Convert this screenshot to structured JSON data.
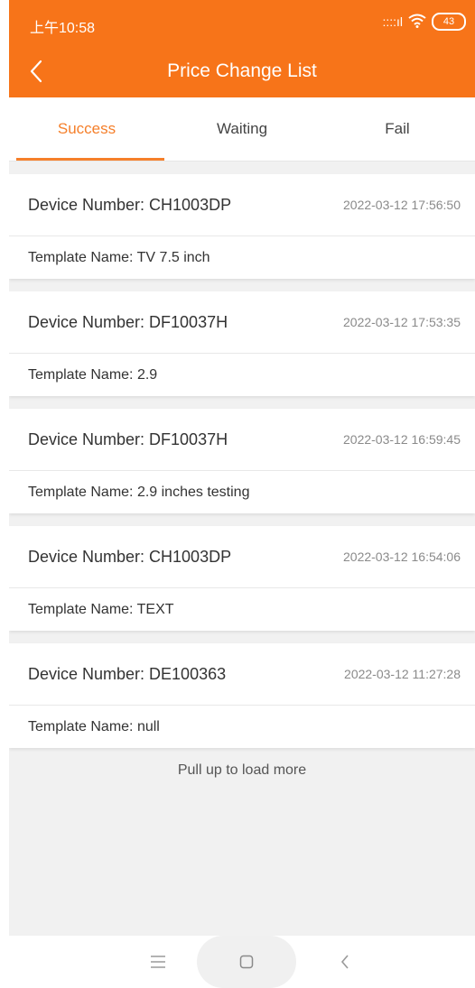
{
  "status_bar": {
    "time": "上午10:58",
    "signal": "::::ıl",
    "battery": "43"
  },
  "app_bar": {
    "title": "Price Change List"
  },
  "tabs": [
    {
      "label": "Success",
      "active": true
    },
    {
      "label": "Waiting",
      "active": false
    },
    {
      "label": "Fail",
      "active": false
    }
  ],
  "records": [
    {
      "device": "Device Number: CH1003DP",
      "time": "2022-03-12 17:56:50",
      "template": "Template Name: TV 7.5 inch"
    },
    {
      "device": "Device Number: DF10037H",
      "time": "2022-03-12 17:53:35",
      "template": "Template Name: 2.9"
    },
    {
      "device": "Device Number: DF10037H",
      "time": "2022-03-12 16:59:45",
      "template": "Template Name: 2.9 inches testing"
    },
    {
      "device": "Device Number: CH1003DP",
      "time": "2022-03-12 16:54:06",
      "template": "Template Name: TEXT"
    },
    {
      "device": "Device Number: DE100363",
      "time": "2022-03-12 11:27:28",
      "template": "Template Name: null"
    }
  ],
  "load_more": "Pull up to load more",
  "colors": {
    "accent": "#f77419",
    "tab_active": "#f57f2a"
  }
}
